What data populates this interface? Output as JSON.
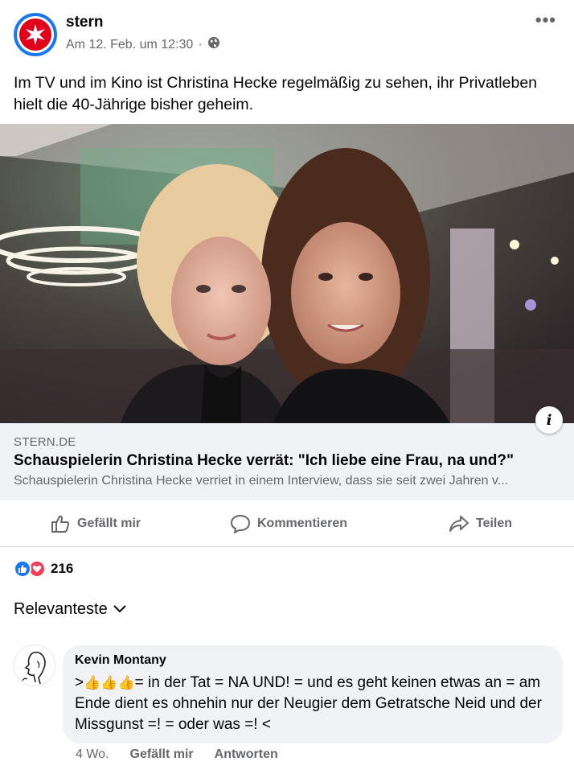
{
  "header": {
    "page_name": "stern",
    "timestamp": "Am 12. Feb. um 12:30",
    "separator": "·",
    "audience_icon": "globe-icon",
    "more_icon": "more-options-icon",
    "more_glyph": "•••",
    "logo_icon": "stern-star-logo-icon"
  },
  "post": {
    "text": "Im TV und im Kino ist Christina Hecke regelmäßig zu sehen, ihr Privatleben hielt die 40-Jährige bisher geheim."
  },
  "photo": {
    "info_glyph": "i"
  },
  "link_preview": {
    "domain": "STERN.DE",
    "title": "Schauspielerin Christina Hecke verrät: \"Ich liebe eine Frau, na und?\"",
    "description": "Schauspielerin Christina Hecke verriet in einem Interview, dass sie seit zwei Jahren v..."
  },
  "actions": {
    "like_label": "Gefällt mir",
    "comment_label": "Kommentieren",
    "share_label": "Teilen"
  },
  "reactions": {
    "count": "216",
    "types": [
      "like",
      "love"
    ]
  },
  "comments_sort": {
    "label": "Relevanteste"
  },
  "comment": {
    "author": "Kevin Montany",
    "text_prefix": ">",
    "emoji": "👍",
    "text_body": "= in der Tat = NA UND! = und es geht keinen etwas an = am Ende dient es ohnehin nur der  Neugier dem Getratsche Neid und der Missgunst =! = oder was =! <",
    "time": "4 Wo.",
    "like_label": "Gefällt mir",
    "reply_label": "Antworten"
  },
  "colors": {
    "facebook_blue": "#1877f2",
    "love_red": "#f33e58",
    "stern_red": "#e2001a",
    "secondary_text": "#65676b",
    "bubble_bg": "#f0f2f5"
  }
}
